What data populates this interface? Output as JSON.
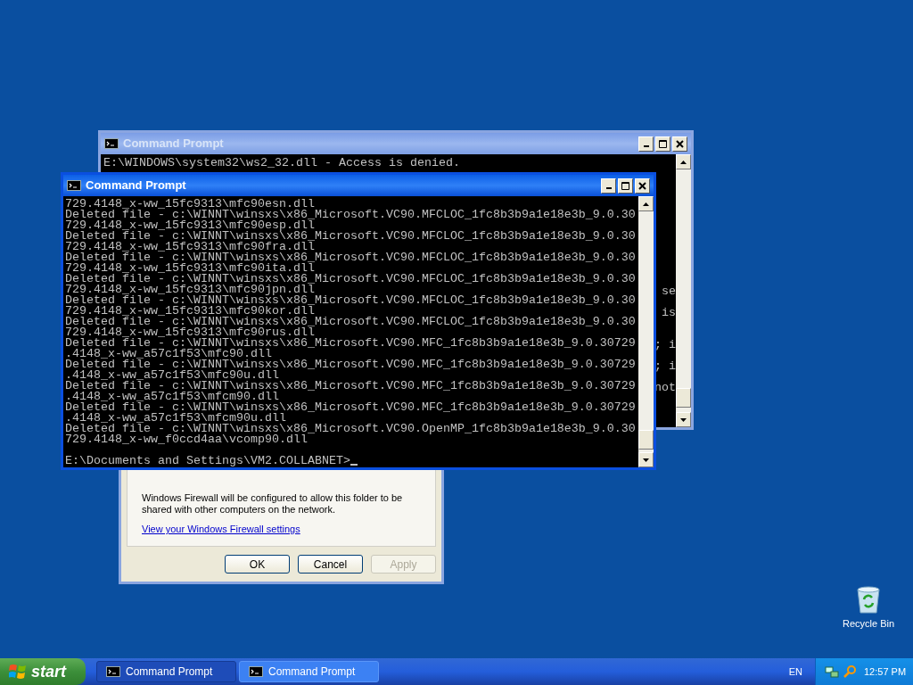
{
  "back_window": {
    "title": "Command Prompt",
    "active": false,
    "first_line": "E:\\WINDOWS\\system32\\ws2_32.dll - Access is denied.",
    "line_ends": [
      "se",
      "is",
      "; i",
      "; i",
      "not"
    ]
  },
  "dialog": {
    "message": "Windows Firewall will be configured to allow this folder to be shared with other computers on the network.",
    "link": "View your Windows Firewall settings",
    "buttons": [
      {
        "label": "OK",
        "disabled": false
      },
      {
        "label": "Cancel",
        "disabled": false
      },
      {
        "label": "Apply",
        "disabled": true
      }
    ]
  },
  "front_window": {
    "title": "Command Prompt",
    "active": true,
    "lines": [
      "729.4148_x-ww_15fc9313\\mfc90esn.dll",
      "Deleted file - c:\\WINNT\\winsxs\\x86_Microsoft.VC90.MFCLOC_1fc8b3b9a1e18e3b_9.0.30",
      "729.4148_x-ww_15fc9313\\mfc90esp.dll",
      "Deleted file - c:\\WINNT\\winsxs\\x86_Microsoft.VC90.MFCLOC_1fc8b3b9a1e18e3b_9.0.30",
      "729.4148_x-ww_15fc9313\\mfc90fra.dll",
      "Deleted file - c:\\WINNT\\winsxs\\x86_Microsoft.VC90.MFCLOC_1fc8b3b9a1e18e3b_9.0.30",
      "729.4148_x-ww_15fc9313\\mfc90ita.dll",
      "Deleted file - c:\\WINNT\\winsxs\\x86_Microsoft.VC90.MFCLOC_1fc8b3b9a1e18e3b_9.0.30",
      "729.4148_x-ww_15fc9313\\mfc90jpn.dll",
      "Deleted file - c:\\WINNT\\winsxs\\x86_Microsoft.VC90.MFCLOC_1fc8b3b9a1e18e3b_9.0.30",
      "729.4148_x-ww_15fc9313\\mfc90kor.dll",
      "Deleted file - c:\\WINNT\\winsxs\\x86_Microsoft.VC90.MFCLOC_1fc8b3b9a1e18e3b_9.0.30",
      "729.4148_x-ww_15fc9313\\mfc90rus.dll",
      "Deleted file - c:\\WINNT\\winsxs\\x86_Microsoft.VC90.MFC_1fc8b3b9a1e18e3b_9.0.30729",
      ".4148_x-ww_a57c1f53\\mfc90.dll",
      "Deleted file - c:\\WINNT\\winsxs\\x86_Microsoft.VC90.MFC_1fc8b3b9a1e18e3b_9.0.30729",
      ".4148_x-ww_a57c1f53\\mfc90u.dll",
      "Deleted file - c:\\WINNT\\winsxs\\x86_Microsoft.VC90.MFC_1fc8b3b9a1e18e3b_9.0.30729",
      ".4148_x-ww_a57c1f53\\mfcm90.dll",
      "Deleted file - c:\\WINNT\\winsxs\\x86_Microsoft.VC90.MFC_1fc8b3b9a1e18e3b_9.0.30729",
      ".4148_x-ww_a57c1f53\\mfcm90u.dll",
      "Deleted file - c:\\WINNT\\winsxs\\x86_Microsoft.VC90.OpenMP_1fc8b3b9a1e18e3b_9.0.30",
      "729.4148_x-ww_f0ccd4aa\\vcomp90.dll"
    ],
    "prompt": "E:\\Documents and Settings\\VM2.COLLABNET>"
  },
  "desktop_icons": [
    {
      "label": "Recycle Bin"
    }
  ],
  "taskbar": {
    "start": "start",
    "tasks": [
      {
        "label": "Command Prompt",
        "selected": true
      },
      {
        "label": "Command Prompt",
        "selected": false
      }
    ],
    "language": "EN",
    "clock": "12:57 PM"
  }
}
